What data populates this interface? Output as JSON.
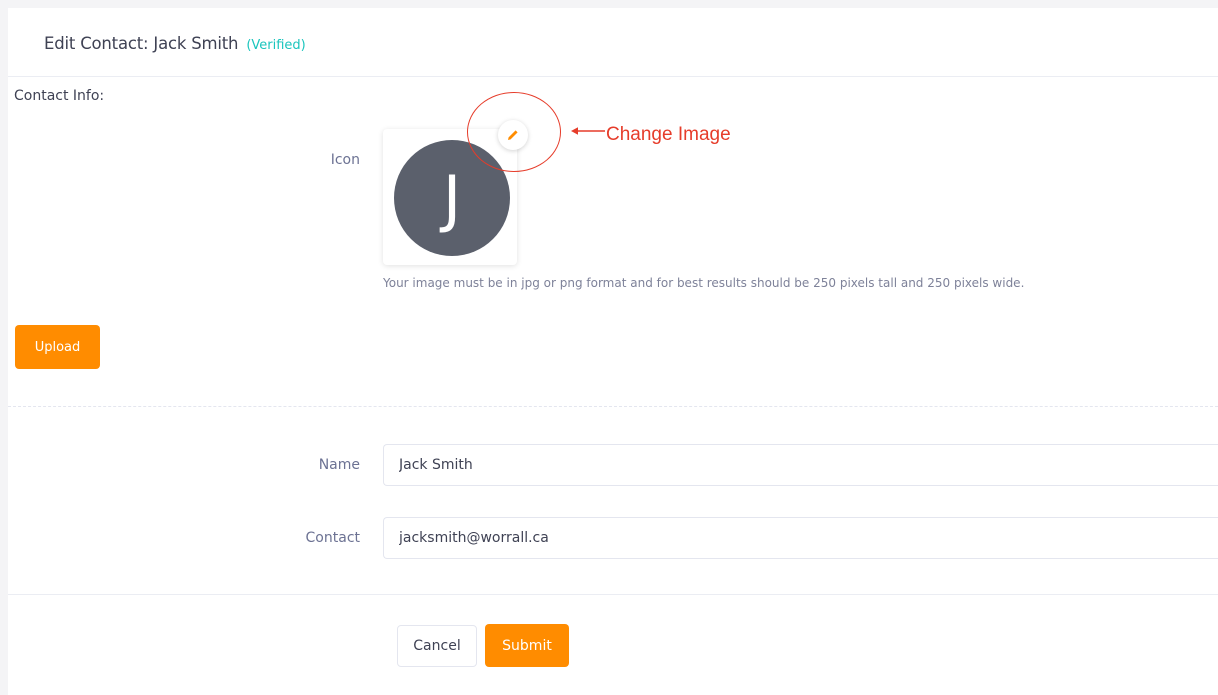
{
  "header": {
    "title": "Edit Contact: Jack Smith",
    "status_badge": "(Verified)"
  },
  "section": {
    "label": "Contact Info:"
  },
  "icon_field": {
    "label": "Icon",
    "avatar_letter": "J",
    "hint": "Your image must be in jpg or png format and for best results should be 250 pixels tall and 250 pixels wide.",
    "annotation": "Change Image",
    "edit_icon": "pencil-icon"
  },
  "upload_button": "Upload",
  "form": {
    "name_label": "Name",
    "name_value": "Jack Smith",
    "contact_label": "Contact",
    "contact_value": "jacksmith@worrall.ca"
  },
  "actions": {
    "cancel": "Cancel",
    "submit": "Submit"
  },
  "colors": {
    "accent": "#ff8c00",
    "verified": "#1bc5bd",
    "avatar_bg": "#5b606c",
    "annotation": "#e63c2a"
  }
}
